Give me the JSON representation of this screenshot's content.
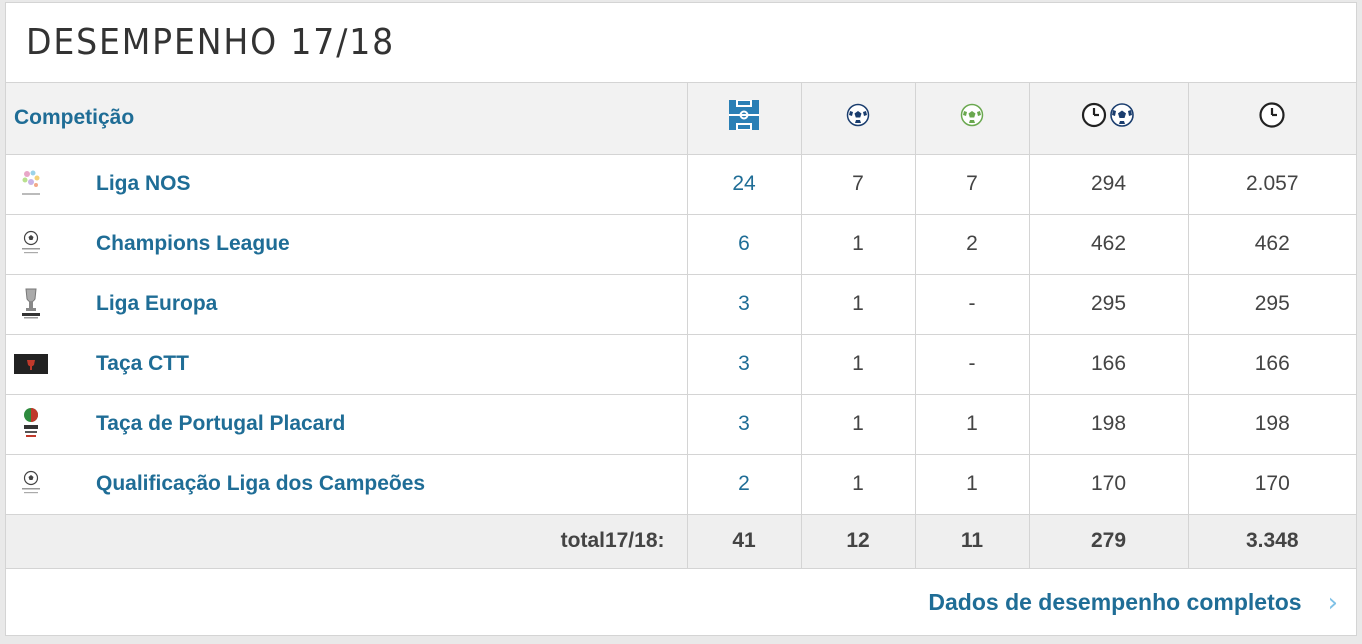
{
  "title": "DESEMPENHO 17/18",
  "header": {
    "competition_label": "Competição",
    "icons": [
      "pitch-icon",
      "goal-ball-icon",
      "assist-ball-icon",
      "minutes-per-goal-icon",
      "minutes-icon"
    ]
  },
  "rows": [
    {
      "name": "Liga NOS",
      "logo": "liga-nos-logo",
      "games": "24",
      "goals": "7",
      "assists": "7",
      "min_per_goal": "294",
      "minutes": "2.057"
    },
    {
      "name": "Champions League",
      "logo": "champions-league-logo",
      "games": "6",
      "goals": "1",
      "assists": "2",
      "min_per_goal": "462",
      "minutes": "462"
    },
    {
      "name": "Liga Europa",
      "logo": "europa-league-logo",
      "games": "3",
      "goals": "1",
      "assists": "-",
      "min_per_goal": "295",
      "minutes": "295"
    },
    {
      "name": "Taça CTT",
      "logo": "taca-ctt-logo",
      "games": "3",
      "goals": "1",
      "assists": "-",
      "min_per_goal": "166",
      "minutes": "166"
    },
    {
      "name": "Taça de Portugal Placard",
      "logo": "taca-portugal-logo",
      "games": "3",
      "goals": "1",
      "assists": "1",
      "min_per_goal": "198",
      "minutes": "198"
    },
    {
      "name": "Qualificação Liga dos Campeões",
      "logo": "champions-qualification-logo",
      "games": "2",
      "goals": "1",
      "assists": "1",
      "min_per_goal": "170",
      "minutes": "170"
    }
  ],
  "totals": {
    "label": "total17/18:",
    "games": "41",
    "goals": "12",
    "assists": "11",
    "min_per_goal": "279",
    "minutes": "3.348"
  },
  "footer": {
    "link_label": "Dados de desempenho completos",
    "chevron": "›"
  },
  "colors": {
    "link": "#1f6d96",
    "pitch": "#2a7fb5",
    "assist_ball": "#6aa84f",
    "chevron": "#7fc1e6"
  }
}
